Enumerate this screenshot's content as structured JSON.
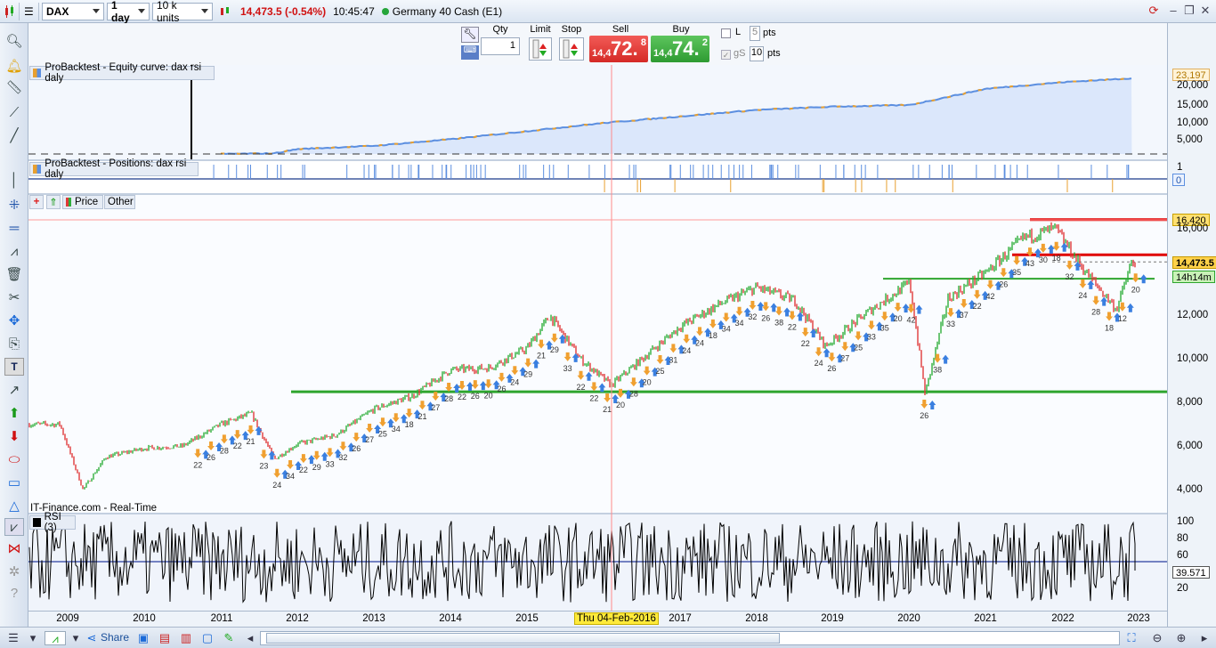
{
  "toolbar": {
    "instrument": "DAX",
    "timeframe": "1 day",
    "units": "10 k units",
    "last_price": "14,473.5 (-0.54%)",
    "time": "10:45:47",
    "market_name": "Germany 40 Cash (E1)"
  },
  "order": {
    "qty_label": "Qty",
    "qty_value": "1",
    "limit_label": "Limit",
    "stop_label": "Stop",
    "sell_label": "Sell",
    "sell_small": "14,4",
    "sell_big": "72.",
    "sell_sup": "8",
    "buy_label": "Buy",
    "buy_small": "14,4",
    "buy_big": "74.",
    "buy_sup": "2",
    "l_label": "L",
    "l_value": "5",
    "l_unit": "pts",
    "gs_label": "gS",
    "gs_value": "10",
    "gs_unit": "pts"
  },
  "panels": {
    "equity_title": "ProBacktest - Equity curve: dax rsi daly",
    "positions_title": "ProBacktest - Positions: dax rsi daly",
    "price_btn": "Price",
    "other_btn": "Other",
    "source": "IT-Finance.com - Real-Time",
    "rsi_title": "RSI (3)"
  },
  "right_axis": {
    "equity_ticks": [
      "20,000",
      "15,000",
      "10,000",
      "5,000"
    ],
    "equity_last": "23,197",
    "positions_ticks": [
      "1"
    ],
    "positions_last": "0",
    "price_ticks": [
      "16,000",
      "12,000",
      "10,000",
      "8,000",
      "6,000",
      "4,000"
    ],
    "price_resistance": "16,420",
    "price_last": "14,473.5",
    "countdown": "14h14m",
    "rsi_ticks": [
      "100",
      "80",
      "60",
      "20"
    ],
    "rsi_last": "39.571"
  },
  "x_axis": {
    "years": [
      "2009",
      "2010",
      "2011",
      "2012",
      "2013",
      "2014",
      "2015",
      "2017",
      "2018",
      "2019",
      "2020",
      "2021",
      "2022",
      "2023"
    ],
    "cursor_date": "Thu 04-Feb-2016"
  },
  "trade_labels": [
    "22",
    "26",
    "28",
    "22",
    "21",
    "23",
    "24",
    "34",
    "22",
    "29",
    "33",
    "32",
    "26",
    "27",
    "25",
    "34",
    "18",
    "21",
    "27",
    "28",
    "22",
    "26",
    "20",
    "26",
    "24",
    "29",
    "21",
    "29",
    "33",
    "22",
    "22",
    "21",
    "20",
    "28",
    "20",
    "25",
    "31",
    "24",
    "24",
    "18",
    "34",
    "34",
    "32",
    "26",
    "38",
    "22",
    "22",
    "24",
    "26",
    "27",
    "25",
    "33",
    "35",
    "20",
    "42",
    "26",
    "38",
    "33",
    "37",
    "22",
    "42",
    "26",
    "35",
    "43",
    "30",
    "18",
    "32",
    "24",
    "28",
    "18",
    "12",
    "20"
  ],
  "chart_data": {
    "type": "line",
    "title": "DAX",
    "xlabel": "",
    "ylabel": "",
    "price_x": [
      2008.9,
      2009.2,
      2009.5,
      2010.0,
      2010.5,
      2011.0,
      2011.4,
      2011.7,
      2012.0,
      2012.5,
      2013.0,
      2013.5,
      2014.0,
      2014.5,
      2015.0,
      2015.3,
      2015.7,
      2016.1,
      2016.5,
      2017.0,
      2017.5,
      2018.0,
      2018.5,
      2018.9,
      2019.5,
      2020.0,
      2020.2,
      2020.5,
      2021.0,
      2021.5,
      2021.9,
      2022.3,
      2022.7,
      2022.9
    ],
    "price_y": [
      7000,
      4000,
      5500,
      5900,
      6000,
      7000,
      7500,
      5400,
      6100,
      6500,
      7700,
      8300,
      9500,
      9600,
      10500,
      12000,
      10000,
      8800,
      10000,
      11500,
      12500,
      13300,
      12700,
      10600,
      12300,
      13500,
      8400,
      12800,
      14000,
      15600,
      16000,
      14000,
      12300,
      14473.5
    ],
    "price_ylim": [
      3500,
      16500
    ],
    "equity_x": [
      2011.0,
      2011.7,
      2012.0,
      2013.0,
      2014.0,
      2015.0,
      2016.0,
      2017.0,
      2018.0,
      2019.0,
      2020.0,
      2021.0,
      2022.0,
      2022.9
    ],
    "equity_y": [
      0,
      200,
      1500,
      2500,
      4500,
      7000,
      9500,
      11500,
      13500,
      14500,
      15000,
      20000,
      22000,
      23197
    ],
    "equity_ylim": [
      0,
      24000
    ],
    "rsi_period": 3,
    "rsi_last": 39.571,
    "rsi_ylim": [
      0,
      100
    ],
    "support_levels": [
      8500,
      13700
    ],
    "resistance_levels": [
      16420,
      14800
    ],
    "colors": {
      "up": "#2fae3b",
      "down": "#e03a3a",
      "equity": "#5c8fe0",
      "support": "#2ea52e",
      "resistance": "#e00000"
    }
  }
}
